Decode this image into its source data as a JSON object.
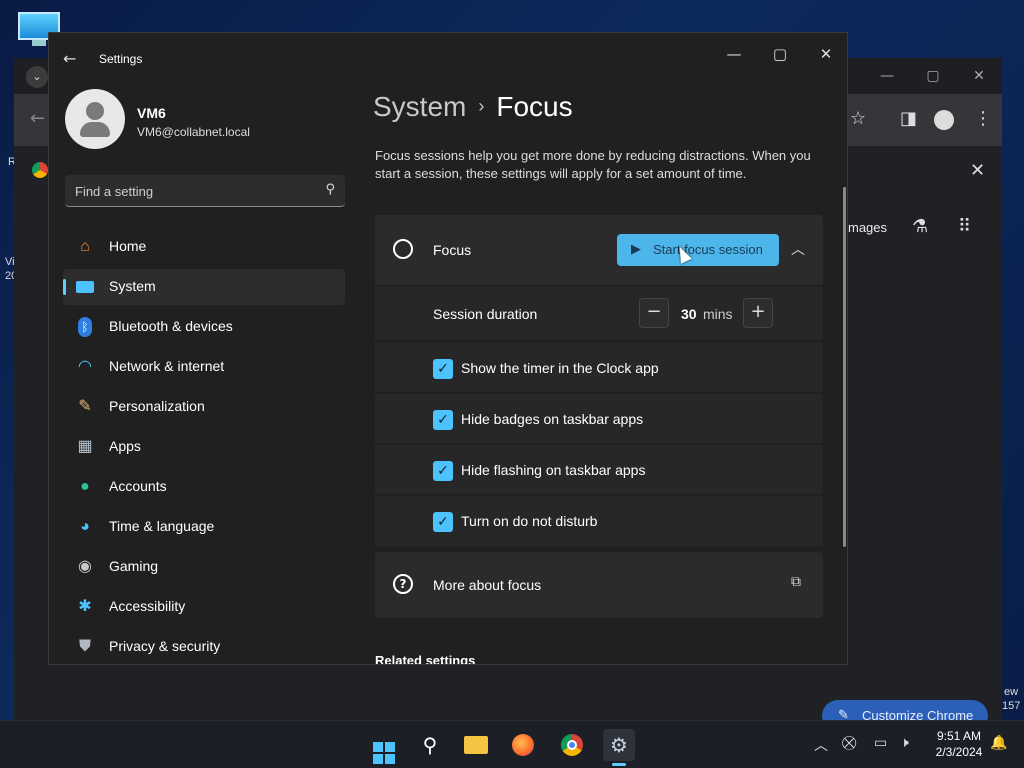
{
  "desktop": {
    "left_text_1": "R",
    "left_text_2": "Vi",
    "left_text_3": "20",
    "right_text_1": "ew",
    "right_text_2": "157"
  },
  "chrome": {
    "images_label": "mages",
    "customize_label": "Customize Chrome"
  },
  "settings": {
    "app_title": "Settings",
    "user": {
      "name": "VM6",
      "email": "VM6@collabnet.local"
    },
    "search": {
      "placeholder": "Find a setting"
    },
    "nav": [
      {
        "label": "Home",
        "icon": "home-icon"
      },
      {
        "label": "System",
        "icon": "system-icon"
      },
      {
        "label": "Bluetooth & devices",
        "icon": "bluetooth-icon"
      },
      {
        "label": "Network & internet",
        "icon": "wifi-icon"
      },
      {
        "label": "Personalization",
        "icon": "brush-icon"
      },
      {
        "label": "Apps",
        "icon": "apps-icon"
      },
      {
        "label": "Accounts",
        "icon": "account-icon"
      },
      {
        "label": "Time & language",
        "icon": "globe-icon"
      },
      {
        "label": "Gaming",
        "icon": "gamepad-icon"
      },
      {
        "label": "Accessibility",
        "icon": "accessibility-icon"
      },
      {
        "label": "Privacy & security",
        "icon": "shield-icon"
      }
    ],
    "breadcrumb": {
      "parent": "System",
      "separator": "›",
      "current": "Focus"
    },
    "description": "Focus sessions help you get more done by reducing distractions. When you start a session, these settings will apply for a set amount of time.",
    "focus_card": {
      "label": "Focus",
      "start_button": "Start focus session"
    },
    "duration": {
      "label": "Session duration",
      "value": "30",
      "unit": "mins"
    },
    "options": [
      {
        "label": "Show the timer in the Clock app",
        "checked": true
      },
      {
        "label": "Hide badges on taskbar apps",
        "checked": true
      },
      {
        "label": "Hide flashing on taskbar apps",
        "checked": true
      },
      {
        "label": "Turn on do not disturb",
        "checked": true
      }
    ],
    "more_about": "More about focus",
    "related_settings": "Related settings"
  },
  "taskbar": {
    "time": "9:51 AM",
    "date": "2/3/2024"
  },
  "colors": {
    "accent": "#4cc2ff",
    "button": "#4cb6ea",
    "window_bg": "#202020",
    "card_bg": "#2b2b2b"
  }
}
